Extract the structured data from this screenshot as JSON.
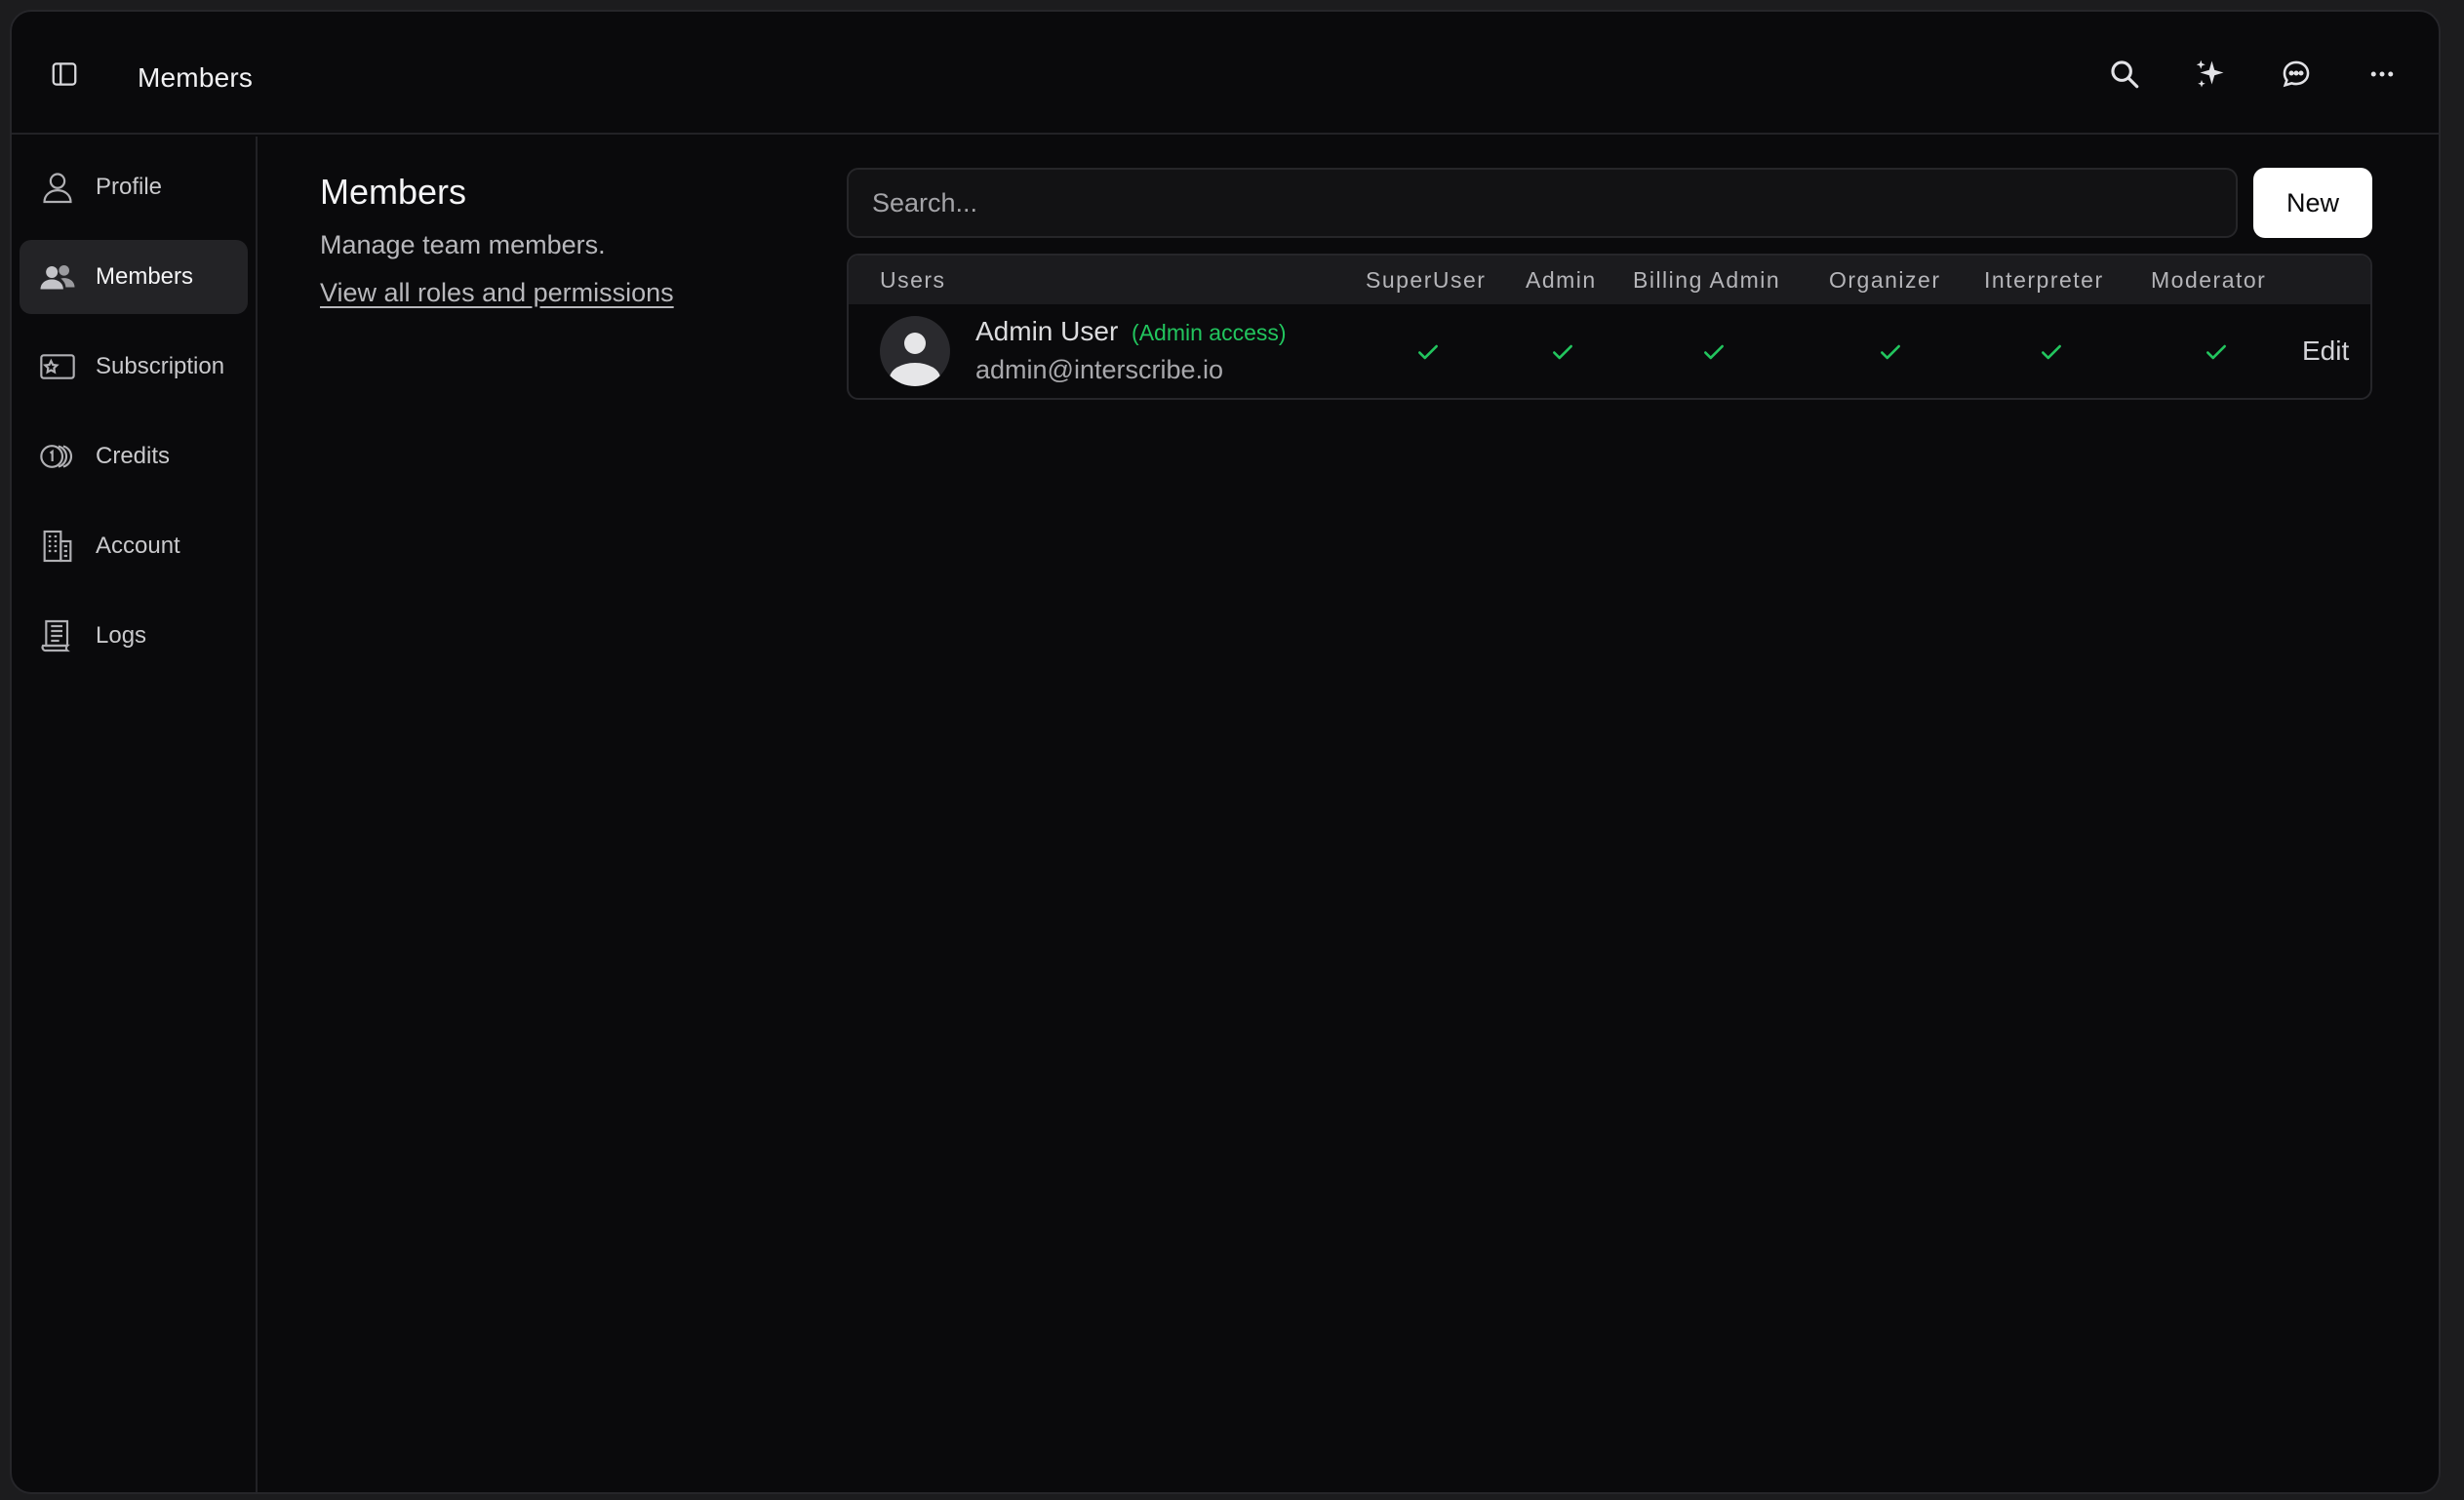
{
  "window": {
    "title": "Members"
  },
  "topbar": {
    "icons": [
      "search-icon",
      "sparkles-icon",
      "chat-icon",
      "more-icon"
    ]
  },
  "sidebar": {
    "items": [
      {
        "label": "Profile",
        "icon": "user-icon",
        "active": false
      },
      {
        "label": "Members",
        "icon": "users-icon",
        "active": true
      },
      {
        "label": "Subscription",
        "icon": "star-card-icon",
        "active": false
      },
      {
        "label": "Credits",
        "icon": "coins-icon",
        "active": false
      },
      {
        "label": "Account",
        "icon": "building-icon",
        "active": false
      },
      {
        "label": "Logs",
        "icon": "log-scroll-icon",
        "active": false
      }
    ]
  },
  "main": {
    "title": "Members",
    "description": "Manage team members.",
    "roles_link": "View all roles and permissions",
    "search": {
      "placeholder": "Search...",
      "value": ""
    },
    "new_button": "New",
    "table": {
      "columns": [
        "Users",
        "SuperUser",
        "Admin",
        "Billing Admin",
        "Organizer",
        "Interpreter",
        "Moderator"
      ],
      "rows": [
        {
          "name": "Admin User",
          "badge": "(Admin access)",
          "email": "admin@interscribe.io",
          "roles": {
            "SuperUser": true,
            "Admin": true,
            "Billing Admin": true,
            "Organizer": true,
            "Interpreter": true,
            "Moderator": true
          },
          "action": "Edit"
        }
      ]
    }
  },
  "colors": {
    "accent_green": "#22c55e",
    "background": "#0a0a0c",
    "active_item": "#232326"
  }
}
